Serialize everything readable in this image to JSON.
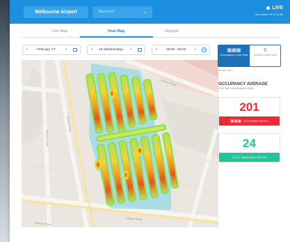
{
  "header": {
    "airport": "Melbourne Airport",
    "terminal": "Terminal 2",
    "live_label": "LIVE",
    "last_update": "Last update: 05:11:06 AM"
  },
  "tabs": [
    {
      "label": "Live Map",
      "active": false
    },
    {
      "label": "Heat Map",
      "active": true
    },
    {
      "label": "Reports",
      "active": false
    }
  ],
  "filters": {
    "month": "February '17",
    "day": "19 (Wednesday)",
    "time": "08:00 - 09:00"
  },
  "view_toggle": {
    "occupancy": "Occupancy Level View",
    "activity": "Activity Level View"
  },
  "whats_this": "What's this?",
  "occupancy": {
    "title": "OCCUPANCY AVERAGE",
    "subtitle": "FOR THE HOUR 08:00-09:00",
    "occupied_value": "201",
    "occupied_label": "OCCUPIED SPOTS",
    "available_value": "24",
    "available_label": "AVAILABLE SPOTS"
  },
  "map": {
    "streets": [
      "Centre Road",
      "Mercer Drive",
      "Grants Road",
      "Melrose Drive",
      "Sharps Road"
    ]
  },
  "colors": {
    "accent": "#1d8fe0",
    "occupied": "#f02a35",
    "available": "#22c49a"
  }
}
